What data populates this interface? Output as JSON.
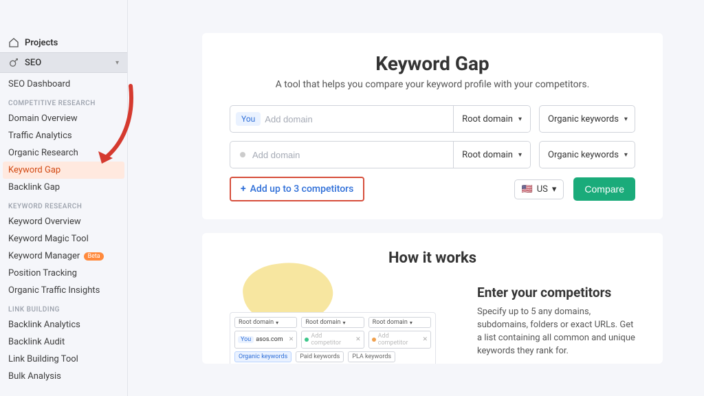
{
  "sidebar": {
    "projects": "Projects",
    "seo": "SEO",
    "seo_dashboard": "SEO Dashboard",
    "sections": {
      "competitive": {
        "label": "COMPETITIVE RESEARCH",
        "items": [
          "Domain Overview",
          "Traffic Analytics",
          "Organic Research",
          "Keyword Gap",
          "Backlink Gap"
        ]
      },
      "keyword": {
        "label": "KEYWORD RESEARCH",
        "items": [
          "Keyword Overview",
          "Keyword Magic Tool",
          "Keyword Manager",
          "Position Tracking",
          "Organic Traffic Insights"
        ],
        "beta_badge": "Beta"
      },
      "link": {
        "label": "LINK BUILDING",
        "items": [
          "Backlink Analytics",
          "Backlink Audit",
          "Link Building Tool",
          "Bulk Analysis"
        ]
      }
    }
  },
  "main": {
    "title": "Keyword Gap",
    "subtitle": "A tool that helps you compare your keyword profile with your competitors.",
    "you_chip": "You",
    "add_domain_placeholder": "Add domain",
    "root_domain": "Root domain",
    "organic_keywords": "Organic keywords",
    "add_competitors": "Add up to 3 competitors",
    "country": "US",
    "compare": "Compare"
  },
  "how": {
    "title": "How it works",
    "heading": "Enter your competitors",
    "body": "Specify up to 5 any domains, subdomains, folders or exact URLs. Get a list containing all common and unique keywords they rank for.",
    "mini": {
      "root": "Root domain",
      "you": "You",
      "asos": "asos.com",
      "add": "Add competitor",
      "kw": [
        "Organic keywords",
        "Paid keywords",
        "PLA keywords"
      ]
    }
  }
}
